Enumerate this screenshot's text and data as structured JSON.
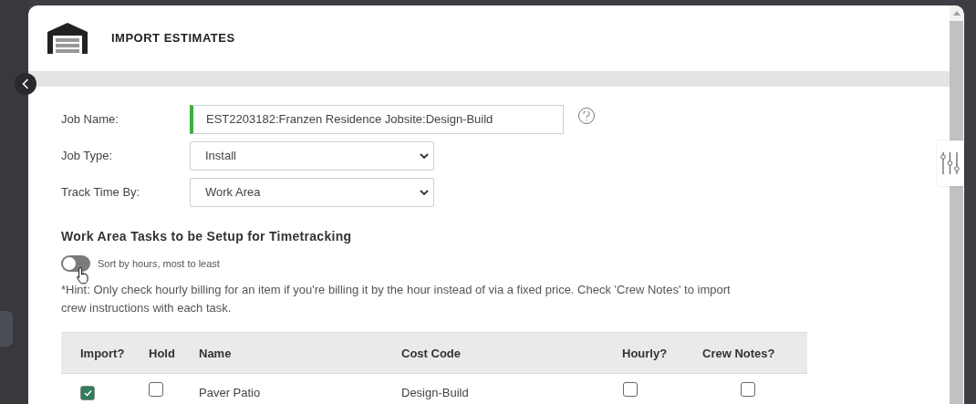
{
  "dialog": {
    "title": "IMPORT ESTIMATES"
  },
  "form": {
    "fields": [
      {
        "kind": "text",
        "label": "Job Name:",
        "value": "EST2203182:Franzen Residence Jobsite:Design-Build"
      },
      {
        "kind": "select",
        "label": "Job Type:",
        "value": "Install"
      },
      {
        "kind": "select",
        "label": "Track Time By:",
        "value": "Work Area"
      }
    ]
  },
  "section": {
    "title": "Work Area Tasks to be Setup for Timetracking",
    "toggle": {
      "label": "Sort by hours, most to least",
      "on": false
    },
    "hint": "*Hint: Only check hourly billing for an item if you're billing it by the hour instead of via a fixed price. Check 'Crew Notes' to import crew instructions with each task."
  },
  "table": {
    "columns": [
      "Import?",
      "Hold",
      "Name",
      "Cost Code",
      "Hourly?",
      "Crew Notes?"
    ],
    "rows": [
      {
        "import": true,
        "hold": false,
        "name": "Paver Patio",
        "cost_code": "Design-Build",
        "hourly": false,
        "crew_notes": false
      }
    ]
  }
}
